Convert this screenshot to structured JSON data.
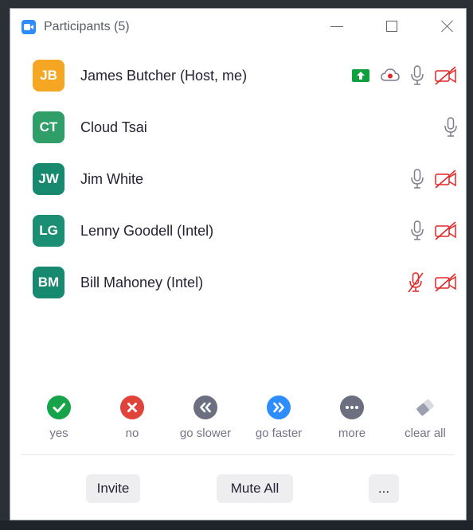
{
  "window": {
    "title": "Participants (5)"
  },
  "colors": {
    "accent": "#2d8cff",
    "muted_red": "#e02828",
    "share_green": "#0e9f3f"
  },
  "participants": [
    {
      "initials": "JB",
      "name": "James Butcher (Host, me)",
      "avatar_color": "#f5a623",
      "icons": [
        "share-screen-icon",
        "cloud-record-icon",
        "mic-icon",
        "video-off-icon"
      ]
    },
    {
      "initials": "CT",
      "name": "Cloud Tsai",
      "avatar_color": "#2f9e68",
      "icons": [
        "mic-icon"
      ]
    },
    {
      "initials": "JW",
      "name": "Jim White",
      "avatar_color": "#17896e",
      "icons": [
        "mic-icon",
        "video-off-icon"
      ]
    },
    {
      "initials": "LG",
      "name": "Lenny Goodell (Intel)",
      "avatar_color": "#1b8f74",
      "icons": [
        "mic-icon",
        "video-off-icon"
      ]
    },
    {
      "initials": "BM",
      "name": "Bill Mahoney (Intel)",
      "avatar_color": "#17896e",
      "icons": [
        "mic-off-icon",
        "video-off-icon"
      ]
    }
  ],
  "reactions": [
    {
      "label": "yes",
      "icon": "check-icon",
      "color": "#16a34a"
    },
    {
      "label": "no",
      "icon": "x-icon",
      "color": "#e0433a"
    },
    {
      "label": "go slower",
      "icon": "rewind-icon",
      "color": "#6b6f80"
    },
    {
      "label": "go faster",
      "icon": "fast-forward-icon",
      "color": "#2d8cff"
    },
    {
      "label": "more",
      "icon": "ellipsis-icon",
      "color": "#6b6f80"
    },
    {
      "label": "clear all",
      "icon": "eraser-icon",
      "color": "#9aa0ad"
    }
  ],
  "footer": {
    "invite_label": "Invite",
    "mute_all_label": "Mute All",
    "more_label": "..."
  }
}
